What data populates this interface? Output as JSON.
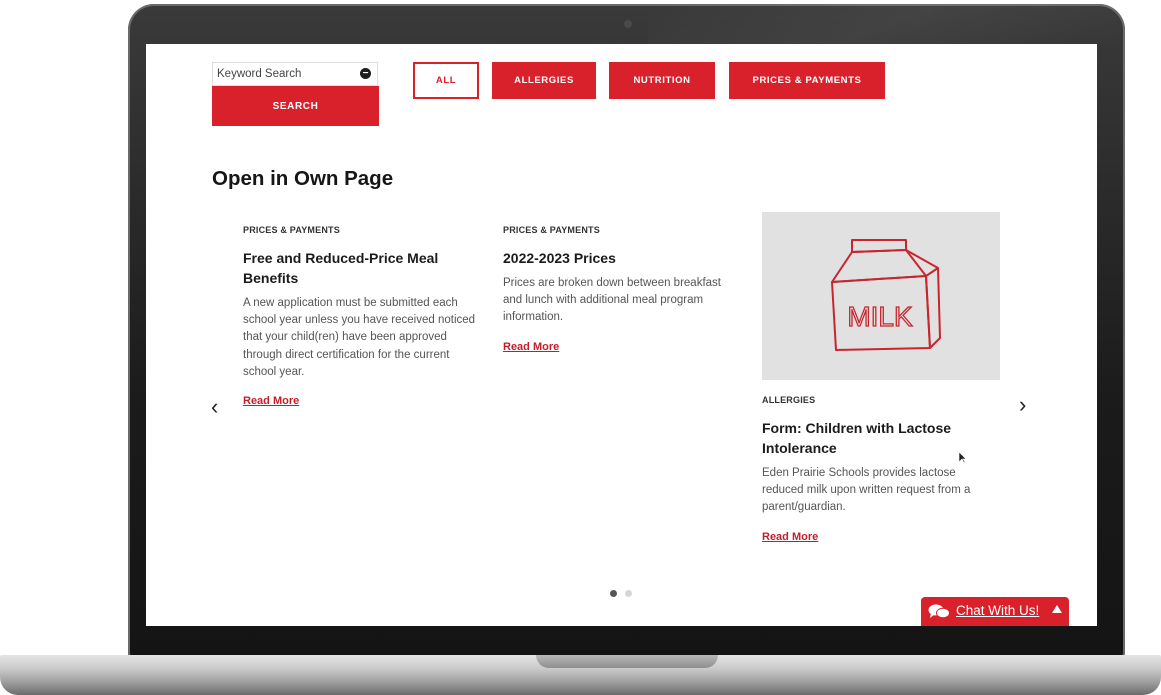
{
  "search": {
    "placeholder": "Keyword Search",
    "button_label": "SEARCH"
  },
  "filters": [
    {
      "label": "ALL",
      "selected": true
    },
    {
      "label": "ALLERGIES",
      "selected": false
    },
    {
      "label": "NUTRITION",
      "selected": false
    },
    {
      "label": "PRICES & PAYMENTS",
      "selected": false
    }
  ],
  "section": {
    "title": "Open in Own Page"
  },
  "cards": [
    {
      "category": "PRICES & PAYMENTS",
      "title": "Free and Reduced-Price Meal Benefits",
      "description": "A new application must be submitted each school year unless you have received noticed that your child(ren) have been approved through direct certification for the current school year.",
      "link": "Read More"
    },
    {
      "category": "PRICES & PAYMENTS",
      "title": "2022-2023 Prices",
      "description": "Prices are broken down between breakfast and lunch with additional meal program information.",
      "link": "Read More"
    },
    {
      "category": "ALLERGIES",
      "title": "Form: Children with Lactose Intolerance",
      "description": "Eden Prairie Schools provides lactose reduced milk upon written request from a parent/guardian.",
      "link": "Read More",
      "image_text": "MILK"
    }
  ],
  "carousel": {
    "prev_icon": "chevron-left-icon",
    "next_icon": "chevron-right-icon",
    "active_page": 1,
    "page_count": 2
  },
  "chat": {
    "label": "Chat With Us!"
  },
  "colors": {
    "accent": "#d9212c",
    "link": "#c41d2a",
    "image_bg": "#e1e1e1"
  }
}
